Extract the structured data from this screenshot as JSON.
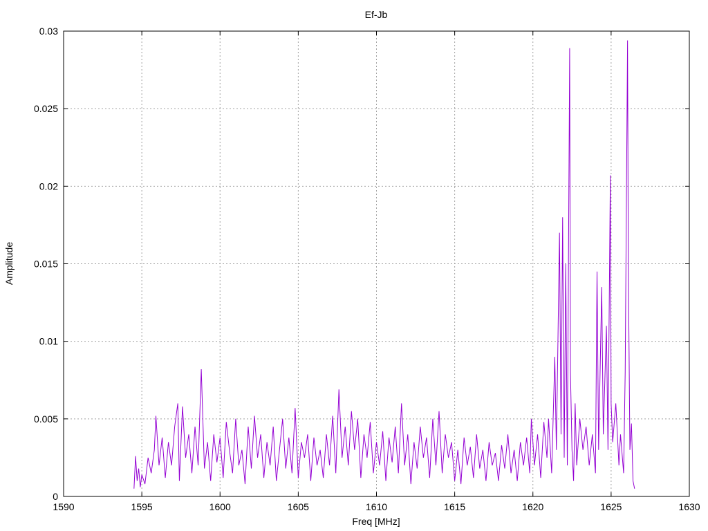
{
  "chart_data": {
    "type": "line",
    "title": "Ef-Jb",
    "xlabel": "Freq [MHz]",
    "ylabel": "Amplitude",
    "xlim": [
      1590,
      1630
    ],
    "ylim": [
      0,
      0.03
    ],
    "x_ticks": [
      1590,
      1595,
      1600,
      1605,
      1610,
      1615,
      1620,
      1625,
      1630
    ],
    "y_ticks": [
      0,
      0.005,
      0.01,
      0.015,
      0.02,
      0.025,
      0.03
    ],
    "x_tick_labels": [
      "1590",
      "1595",
      "1600",
      "1605",
      "1610",
      "1615",
      "1620",
      "1625",
      "1630"
    ],
    "y_tick_labels": [
      "0",
      "0.005",
      "0.01",
      "0.015",
      "0.02",
      "0.025",
      "0.03"
    ],
    "grid": true,
    "series": [
      {
        "color": "#9400d3",
        "points": [
          [
            1594.5,
            0.0005
          ],
          [
            1594.6,
            0.0026
          ],
          [
            1594.7,
            0.001
          ],
          [
            1594.8,
            0.0018
          ],
          [
            1594.9,
            0.0006
          ],
          [
            1595.0,
            0.0014
          ],
          [
            1595.2,
            0.0008
          ],
          [
            1595.4,
            0.0025
          ],
          [
            1595.6,
            0.0015
          ],
          [
            1595.8,
            0.003
          ],
          [
            1595.9,
            0.0052
          ],
          [
            1596.1,
            0.002
          ],
          [
            1596.3,
            0.0038
          ],
          [
            1596.5,
            0.0012
          ],
          [
            1596.7,
            0.0035
          ],
          [
            1596.9,
            0.002
          ],
          [
            1597.1,
            0.0045
          ],
          [
            1597.3,
            0.006
          ],
          [
            1597.4,
            0.001
          ],
          [
            1597.6,
            0.0058
          ],
          [
            1597.8,
            0.0025
          ],
          [
            1598.0,
            0.004
          ],
          [
            1598.2,
            0.0015
          ],
          [
            1598.4,
            0.0045
          ],
          [
            1598.6,
            0.002
          ],
          [
            1598.8,
            0.0082
          ],
          [
            1599.0,
            0.0018
          ],
          [
            1599.2,
            0.0035
          ],
          [
            1599.4,
            0.001
          ],
          [
            1599.6,
            0.004
          ],
          [
            1599.8,
            0.0022
          ],
          [
            1600.0,
            0.0038
          ],
          [
            1600.2,
            0.0012
          ],
          [
            1600.4,
            0.0048
          ],
          [
            1600.6,
            0.003
          ],
          [
            1600.8,
            0.0015
          ],
          [
            1601.0,
            0.005
          ],
          [
            1601.2,
            0.002
          ],
          [
            1601.4,
            0.003
          ],
          [
            1601.6,
            0.0008
          ],
          [
            1601.8,
            0.0045
          ],
          [
            1602.0,
            0.0018
          ],
          [
            1602.2,
            0.0052
          ],
          [
            1602.4,
            0.0025
          ],
          [
            1602.6,
            0.004
          ],
          [
            1602.8,
            0.0012
          ],
          [
            1603.0,
            0.0035
          ],
          [
            1603.2,
            0.002
          ],
          [
            1603.4,
            0.0045
          ],
          [
            1603.6,
            0.001
          ],
          [
            1603.8,
            0.003
          ],
          [
            1604.0,
            0.005
          ],
          [
            1604.2,
            0.0018
          ],
          [
            1604.4,
            0.0038
          ],
          [
            1604.6,
            0.0015
          ],
          [
            1604.8,
            0.0057
          ],
          [
            1605.0,
            0.0012
          ],
          [
            1605.2,
            0.0035
          ],
          [
            1605.4,
            0.0025
          ],
          [
            1605.6,
            0.004
          ],
          [
            1605.8,
            0.001
          ],
          [
            1606.0,
            0.0038
          ],
          [
            1606.2,
            0.002
          ],
          [
            1606.4,
            0.003
          ],
          [
            1606.6,
            0.0012
          ],
          [
            1606.8,
            0.004
          ],
          [
            1607.0,
            0.002
          ],
          [
            1607.2,
            0.0052
          ],
          [
            1607.4,
            0.0015
          ],
          [
            1607.6,
            0.0069
          ],
          [
            1607.8,
            0.0025
          ],
          [
            1608.0,
            0.0045
          ],
          [
            1608.2,
            0.002
          ],
          [
            1608.4,
            0.0055
          ],
          [
            1608.6,
            0.003
          ],
          [
            1608.8,
            0.005
          ],
          [
            1609.0,
            0.0012
          ],
          [
            1609.2,
            0.004
          ],
          [
            1609.4,
            0.0025
          ],
          [
            1609.6,
            0.0048
          ],
          [
            1609.8,
            0.0015
          ],
          [
            1610.0,
            0.0035
          ],
          [
            1610.2,
            0.002
          ],
          [
            1610.4,
            0.0042
          ],
          [
            1610.6,
            0.001
          ],
          [
            1610.8,
            0.0038
          ],
          [
            1611.0,
            0.0022
          ],
          [
            1611.2,
            0.0045
          ],
          [
            1611.4,
            0.0015
          ],
          [
            1611.6,
            0.006
          ],
          [
            1611.8,
            0.002
          ],
          [
            1612.0,
            0.004
          ],
          [
            1612.2,
            0.0008
          ],
          [
            1612.4,
            0.0035
          ],
          [
            1612.6,
            0.0018
          ],
          [
            1612.8,
            0.0045
          ],
          [
            1613.0,
            0.0025
          ],
          [
            1613.2,
            0.0038
          ],
          [
            1613.4,
            0.0012
          ],
          [
            1613.6,
            0.005
          ],
          [
            1613.8,
            0.002
          ],
          [
            1614.0,
            0.0055
          ],
          [
            1614.2,
            0.0015
          ],
          [
            1614.4,
            0.004
          ],
          [
            1614.6,
            0.0025
          ],
          [
            1614.8,
            0.0035
          ],
          [
            1615.0,
            0.001
          ],
          [
            1615.2,
            0.003
          ],
          [
            1615.4,
            0.0008
          ],
          [
            1615.6,
            0.0038
          ],
          [
            1615.8,
            0.002
          ],
          [
            1616.0,
            0.0032
          ],
          [
            1616.2,
            0.0012
          ],
          [
            1616.4,
            0.004
          ],
          [
            1616.6,
            0.0018
          ],
          [
            1616.8,
            0.003
          ],
          [
            1617.0,
            0.001
          ],
          [
            1617.2,
            0.0035
          ],
          [
            1617.4,
            0.002
          ],
          [
            1617.6,
            0.0028
          ],
          [
            1617.8,
            0.001
          ],
          [
            1618.0,
            0.0033
          ],
          [
            1618.2,
            0.0018
          ],
          [
            1618.4,
            0.004
          ],
          [
            1618.6,
            0.0015
          ],
          [
            1618.8,
            0.003
          ],
          [
            1619.0,
            0.001
          ],
          [
            1619.2,
            0.0035
          ],
          [
            1619.4,
            0.002
          ],
          [
            1619.6,
            0.0038
          ],
          [
            1619.8,
            0.0015
          ],
          [
            1619.9,
            0.005
          ],
          [
            1620.1,
            0.002
          ],
          [
            1620.3,
            0.004
          ],
          [
            1620.5,
            0.0012
          ],
          [
            1620.7,
            0.0048
          ],
          [
            1620.9,
            0.0025
          ],
          [
            1621.0,
            0.005
          ],
          [
            1621.2,
            0.0015
          ],
          [
            1621.4,
            0.009
          ],
          [
            1621.5,
            0.003
          ],
          [
            1621.7,
            0.017
          ],
          [
            1621.8,
            0.004
          ],
          [
            1621.9,
            0.018
          ],
          [
            1622.0,
            0.0025
          ],
          [
            1622.1,
            0.015
          ],
          [
            1622.2,
            0.002
          ],
          [
            1622.35,
            0.0289
          ],
          [
            1622.4,
            0.008
          ],
          [
            1622.5,
            0.003
          ],
          [
            1622.6,
            0.001
          ],
          [
            1622.7,
            0.006
          ],
          [
            1622.8,
            0.002
          ],
          [
            1623.0,
            0.005
          ],
          [
            1623.2,
            0.003
          ],
          [
            1623.4,
            0.0045
          ],
          [
            1623.6,
            0.002
          ],
          [
            1623.8,
            0.004
          ],
          [
            1624.0,
            0.0015
          ],
          [
            1624.1,
            0.0145
          ],
          [
            1624.2,
            0.003
          ],
          [
            1624.4,
            0.0135
          ],
          [
            1624.5,
            0.004
          ],
          [
            1624.7,
            0.011
          ],
          [
            1624.8,
            0.003
          ],
          [
            1624.95,
            0.0207
          ],
          [
            1625.0,
            0.006
          ],
          [
            1625.1,
            0.0035
          ],
          [
            1625.3,
            0.006
          ],
          [
            1625.5,
            0.002
          ],
          [
            1625.6,
            0.004
          ],
          [
            1625.8,
            0.0015
          ],
          [
            1625.9,
            0.008
          ],
          [
            1626.05,
            0.0294
          ],
          [
            1626.1,
            0.015
          ],
          [
            1626.2,
            0.003
          ],
          [
            1626.3,
            0.0047
          ],
          [
            1626.4,
            0.001
          ],
          [
            1626.5,
            0.0005
          ]
        ]
      }
    ]
  }
}
